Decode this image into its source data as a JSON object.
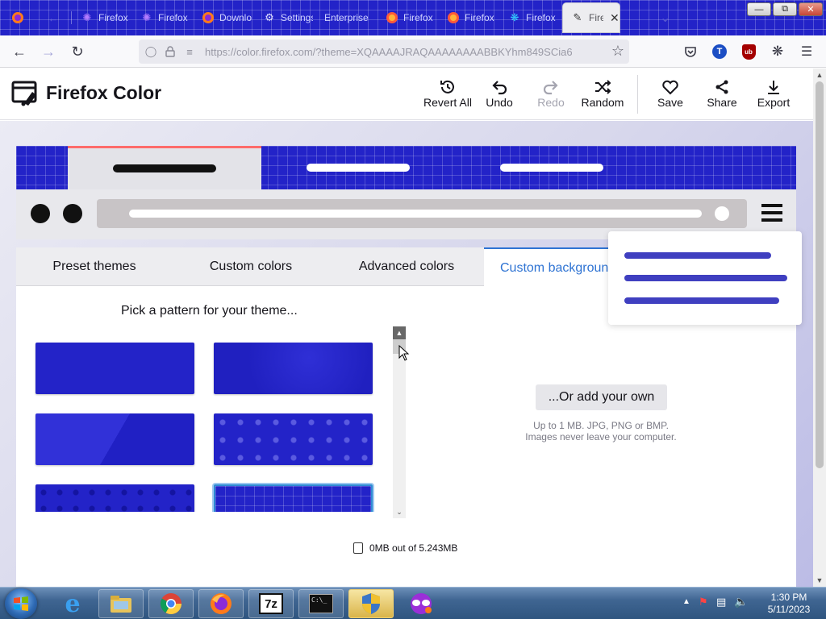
{
  "browser": {
    "tabs": [
      {
        "label": "",
        "icon": "firefox-icon"
      },
      {
        "label": "",
        "icon": "arrow-left-icon"
      },
      {
        "label": "Firefox",
        "icon": "firefox-multi-account-icon"
      },
      {
        "label": "Firefox",
        "icon": "firefox-multi-account-icon"
      },
      {
        "label": "Downloads",
        "icon": "firefox-icon"
      },
      {
        "label": "Settings",
        "icon": "gear-icon"
      },
      {
        "label": "Enterprise",
        "icon": ""
      },
      {
        "label": "Firefox",
        "icon": "firefox-icon"
      },
      {
        "label": "Firefox",
        "icon": "firefox-icon"
      },
      {
        "label": "Firefox",
        "icon": "puzzle-icon"
      },
      {
        "label": "Firefox",
        "icon": "firefox-color-icon",
        "active": true
      }
    ],
    "url": "https://color.firefox.com/?theme=XQAAAAJRAQAAAAAAAABBKYhm849SCia6",
    "url_host": "color.firefox.com",
    "account_initial": "T",
    "ublock_label": "ub"
  },
  "app": {
    "title": "Firefox Color",
    "actions": {
      "revert_all": "Revert All",
      "undo": "Undo",
      "redo": "Redo",
      "random": "Random",
      "save": "Save",
      "share": "Share",
      "export": "Export"
    },
    "tabs": {
      "preset": "Preset themes",
      "custom_colors": "Custom colors",
      "advanced": "Advanced colors",
      "custom_backgrounds": "Custom backgrounds"
    },
    "pattern_title": "Pick a pattern for your theme...",
    "add_own_button": "...Or add your own",
    "hint_line1": "Up to 1 MB. JPG, PNG or BMP.",
    "hint_line2": "Images never leave your computer.",
    "usage": "0MB out of 5.243MB"
  },
  "taskbar": {
    "apps": [
      "ie-icon",
      "file-explorer-icon",
      "chrome-icon",
      "firefox-icon",
      "7zip-icon",
      "cmd-icon",
      "shield-icon",
      "mask-icon"
    ],
    "time": "1:30 PM",
    "date": "5/11/2023"
  },
  "colors": {
    "theme_blue": "#2323c8",
    "accent": "#2e73d3",
    "menu_lines": "#3f3fc0"
  }
}
